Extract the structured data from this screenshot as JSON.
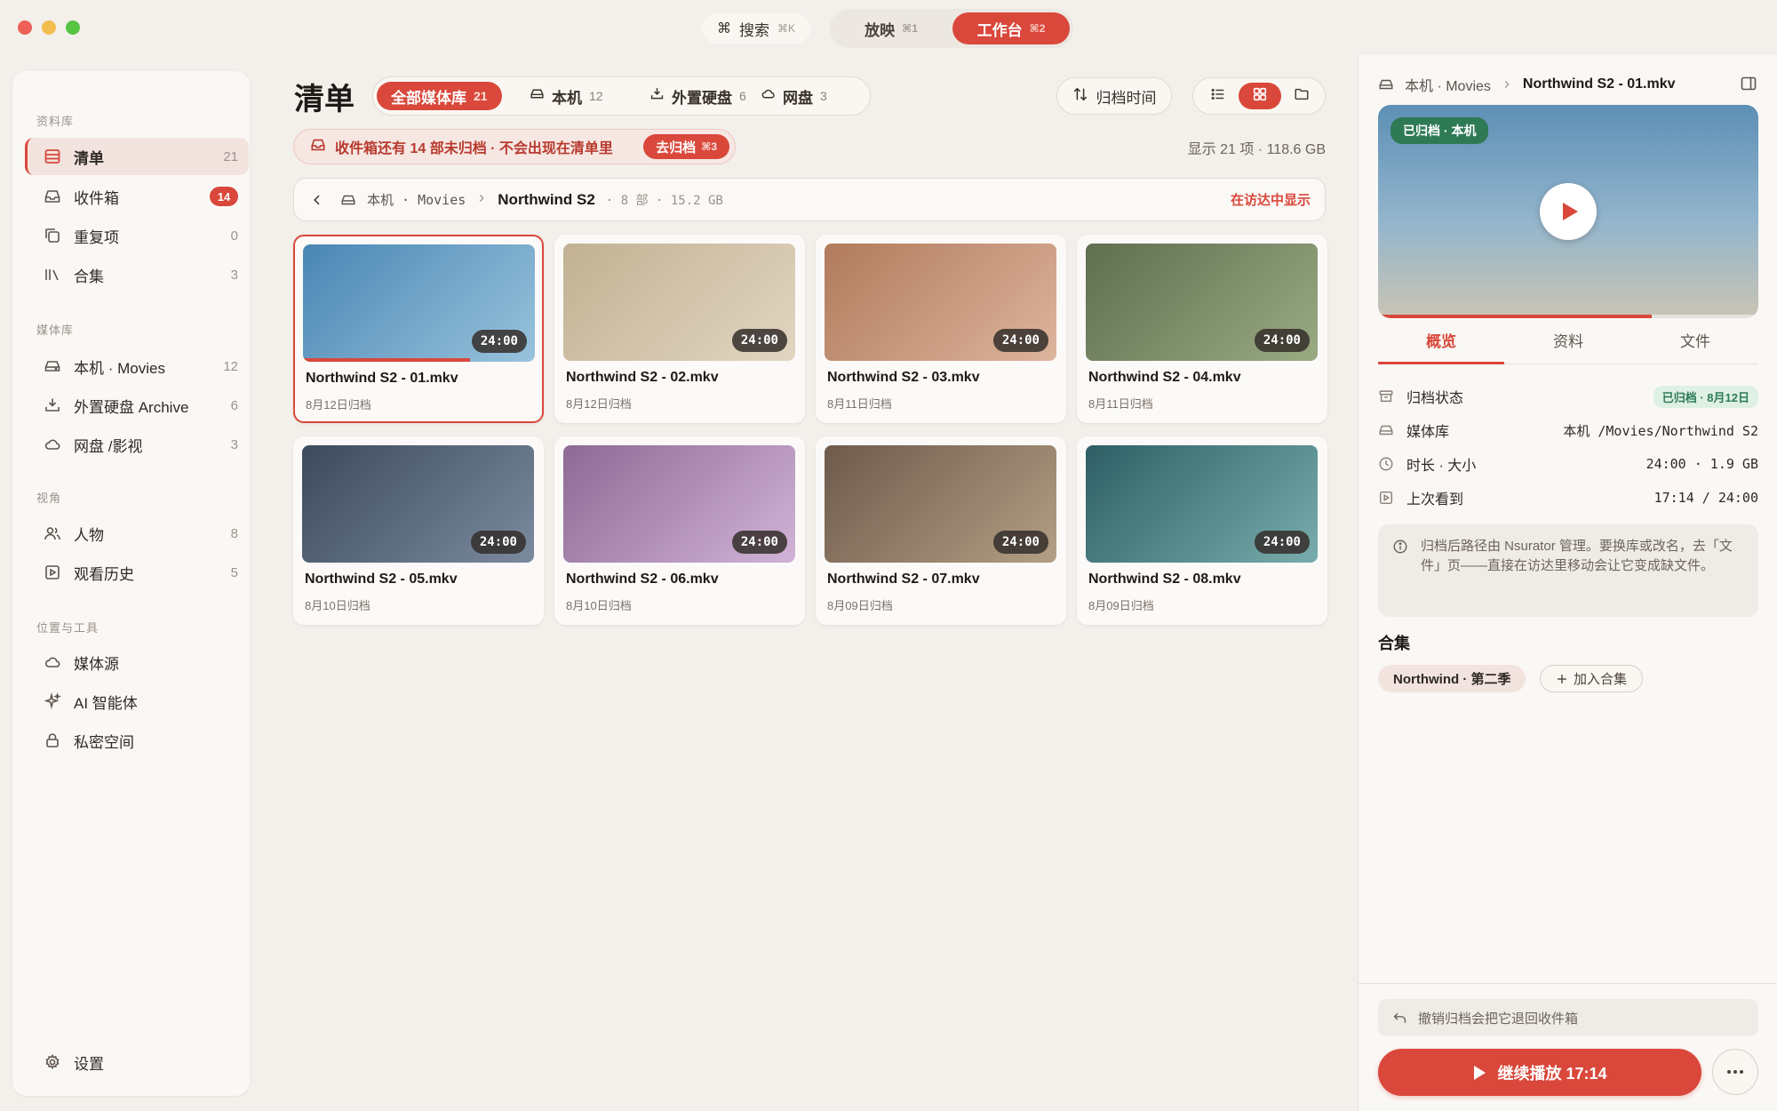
{
  "window": {
    "search_label": "搜索",
    "search_kbd": "⌘K",
    "play_label": "放映",
    "play_kbd": "⌘1",
    "work_label": "工作台",
    "work_kbd": "⌘2",
    "cmd_glyph": "⌘"
  },
  "sidebar": {
    "sections": {
      "library": "资料库",
      "media": "媒体库",
      "view": "视角",
      "tools": "位置与工具"
    },
    "library_items": [
      {
        "label": "清单",
        "count": "21"
      },
      {
        "label": "收件箱",
        "count": "14"
      },
      {
        "label": "重复项",
        "count": "0"
      },
      {
        "label": "合集",
        "count": "3"
      }
    ],
    "media_items": [
      {
        "label": "本机 · Movies",
        "count": "12"
      },
      {
        "label": "外置硬盘 Archive",
        "count": "6"
      },
      {
        "label": "网盘 /影视",
        "count": "3"
      }
    ],
    "view_items": [
      {
        "label": "人物",
        "count": "8"
      },
      {
        "label": "观看历史",
        "count": "5"
      }
    ],
    "tool_items": [
      {
        "label": "媒体源"
      },
      {
        "label": "AI 智能体"
      },
      {
        "label": "私密空间"
      }
    ],
    "settings": "设置"
  },
  "main": {
    "title": "清单",
    "tabs": [
      {
        "label": "全部媒体库",
        "count": "21"
      },
      {
        "label": "本机",
        "count": "12"
      },
      {
        "label": "外置硬盘",
        "count": "6"
      },
      {
        "label": "网盘",
        "count": "3"
      }
    ],
    "sort_label": "归档时间",
    "banner_text": "收件箱还有 14 部未归档 · 不会出现在清单里",
    "banner_action": "去归档",
    "banner_kbd": "⌘3",
    "showing": "显示 21 项 · 118.6 GB",
    "crumb": {
      "root": "本机 · Movies",
      "current": "Northwind S2",
      "meta": "· 8 部 · 15.2 GB",
      "reveal": "在访达中显示"
    },
    "items": [
      {
        "name": "Northwind S2 - 01.mkv",
        "date": "8月12日归档",
        "duration": "24:00",
        "c1": "#4a86b4",
        "c2": "#98c3dc",
        "progress": 0.72
      },
      {
        "name": "Northwind S2 - 02.mkv",
        "date": "8月12日归档",
        "duration": "24:00",
        "c1": "#c2b192",
        "c2": "#e2d6c2",
        "progress": 0
      },
      {
        "name": "Northwind S2 - 03.mkv",
        "date": "8月11日归档",
        "duration": "24:00",
        "c1": "#b17b5c",
        "c2": "#ddb49d",
        "progress": 0
      },
      {
        "name": "Northwind S2 - 04.mkv",
        "date": "8月11日归档",
        "duration": "24:00",
        "c1": "#5f6f50",
        "c2": "#9aaa82",
        "progress": 0
      },
      {
        "name": "Northwind S2 - 05.mkv",
        "date": "8月10日归档",
        "duration": "24:00",
        "c1": "#3c4a5c",
        "c2": "#7b8a9e",
        "progress": 0
      },
      {
        "name": "Northwind S2 - 06.mkv",
        "date": "8月10日归档",
        "duration": "24:00",
        "c1": "#8c6a95",
        "c2": "#d2b3d7",
        "progress": 0
      },
      {
        "name": "Northwind S2 - 07.mkv",
        "date": "8月09日归档",
        "duration": "24:00",
        "c1": "#6e5a4b",
        "c2": "#b39f84",
        "progress": 0
      },
      {
        "name": "Northwind S2 - 08.mkv",
        "date": "8月09日归档",
        "duration": "24:00",
        "c1": "#2e5f65",
        "c2": "#79acac",
        "progress": 0
      }
    ]
  },
  "panel": {
    "crumb_root": "本机 · Movies",
    "crumb_current": "Northwind S2 - 01.mkv",
    "hero_tag": "已归档 · 本机",
    "hero_progress": 0.72,
    "tabs": [
      "概览",
      "资料",
      "文件"
    ],
    "rows": [
      {
        "key": "归档状态",
        "value": "已归档 · 8月12日"
      },
      {
        "key": "媒体库",
        "value": "本机 /Movies/Northwind S2"
      },
      {
        "key": "时长 · 大小",
        "value": "24:00 · 1.9 GB"
      },
      {
        "key": "上次看到",
        "value": "17:14 / 24:00"
      }
    ],
    "info": "归档后路径由 Nsurator 管理。要换库或改名，去「文件」页——直接在访达里移动会让它变成缺文件。",
    "collection_title": "合集",
    "collection_chip": "Northwind · 第二季",
    "add_collection": "加入合集",
    "undo_text": "撤销归档会把它退回收件箱",
    "continue_label": "继续播放 17:14"
  },
  "colors": {
    "accent": "#d9483b",
    "archived_green": "#2e7a55",
    "background": "#f3efea"
  }
}
